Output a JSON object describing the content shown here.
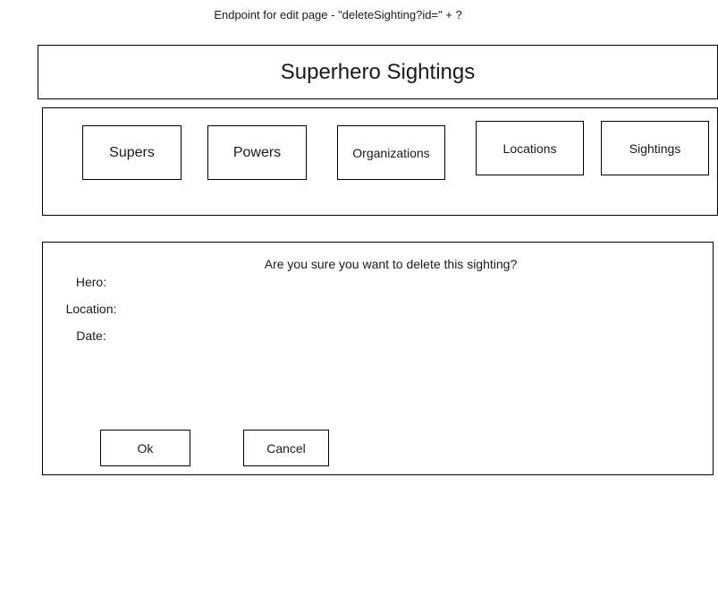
{
  "endpoint_note": "Endpoint for  edit page - \"deleteSighting?id=\" + ?",
  "header": {
    "title": "Superhero Sightings"
  },
  "nav": {
    "items": [
      {
        "label": "Supers"
      },
      {
        "label": "Powers"
      },
      {
        "label": "Organizations"
      },
      {
        "label": "Locations"
      },
      {
        "label": "Sightings"
      }
    ]
  },
  "content": {
    "confirm_text": "Are you sure you want to delete this sighting?",
    "fields": [
      {
        "label": "Hero:"
      },
      {
        "label": "Location:"
      },
      {
        "label": "Date:"
      }
    ],
    "ok_label": "Ok",
    "cancel_label": "Cancel"
  }
}
